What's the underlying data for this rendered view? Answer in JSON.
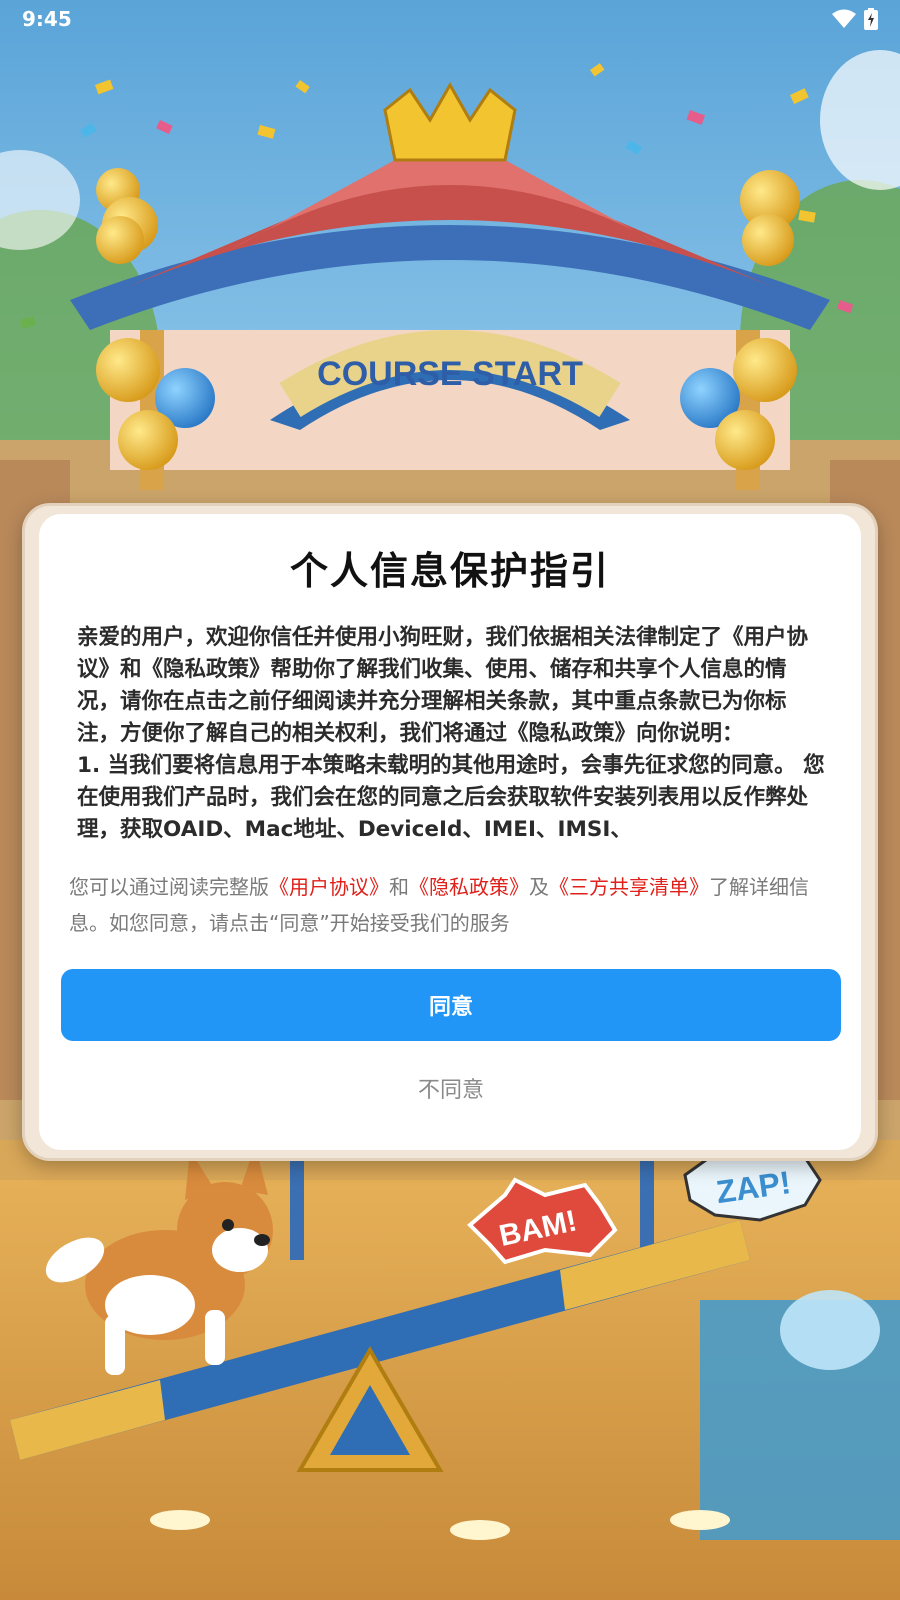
{
  "status_bar": {
    "time": "9:45",
    "icons": [
      "wifi-icon",
      "battery-charging-icon"
    ]
  },
  "background": {
    "sign_text": "COURSE START",
    "burst_1": "BAM!",
    "burst_2": "ZAP!"
  },
  "dialog": {
    "title": "个人信息保护指引",
    "body": "亲爱的用户，欢迎你信任并使用小狗旺财，我们依据相关法律制定了《用户协议》和《隐私政策》帮助你了解我们收集、使用、储存和共享个人信息的情况，请你在点击之前仔细阅读并充分理解相关条款，其中重点条款已为你标注，方便你了解自己的相关权利，我们将通过《隐私政策》向你说明：\n1. 当我们要将信息用于本策略未载明的其他用途时，会事先征求您的同意。 您在使用我们产品时，我们会在您的同意之后会获取软件安装列表用以反作弊处理，获取OAID、Mac地址、DeviceId、IMEI、IMSI、",
    "summary": {
      "prefix": "您可以通过阅读完整版",
      "link_user_agreement": "《用户协议》",
      "and": "和",
      "link_privacy_policy": "《隐私政策》",
      "also": "及",
      "link_third_party": "《三方共享清单》",
      "suffix": "了解详细信息。如您同意，请点击“同意”开始接受我们的服务"
    },
    "agree_label": "同意",
    "disagree_label": "不同意"
  },
  "colors": {
    "accent": "#2196f7",
    "link": "#e0201a",
    "muted_text": "#7a7a7a"
  }
}
